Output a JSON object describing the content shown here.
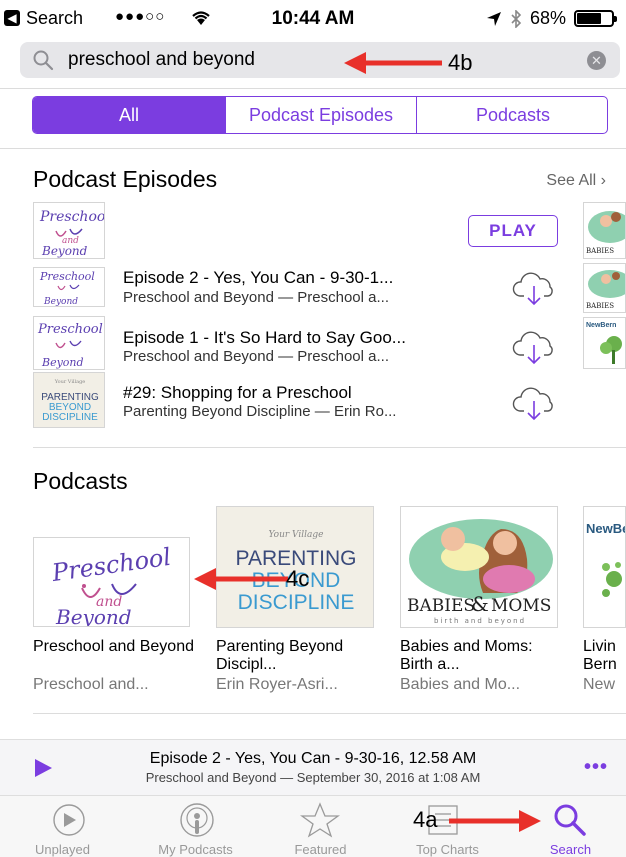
{
  "status_bar": {
    "carrier": "Search",
    "time": "10:44 AM",
    "battery": "68%",
    "battery_level": 0.68
  },
  "search": {
    "value": "preschool and beyond",
    "placeholder": "Search"
  },
  "segments": [
    {
      "label": "All",
      "active": true
    },
    {
      "label": "Podcast Episodes",
      "active": false
    },
    {
      "label": "Podcasts",
      "active": false
    }
  ],
  "episodes_section": {
    "title": "Podcast Episodes",
    "see_all": "See All",
    "play_label": "PLAY",
    "items": [
      {
        "title": "Episode 2 - Yes, You Can - 9-30-1...",
        "subtitle": "Preschool and Beyond — Preschool a..."
      },
      {
        "title": "Episode 1 - It's So Hard to Say Goo...",
        "subtitle": "Preschool and Beyond — Preschool a..."
      },
      {
        "title": "#29: Shopping for a Preschool",
        "subtitle": "Parenting Beyond Discipline — Erin Ro..."
      }
    ]
  },
  "podcasts_section": {
    "title": "Podcasts",
    "items": [
      {
        "title": "Preschool and Beyond",
        "author": "Preschool and..."
      },
      {
        "title": "Parenting Beyond Discipl...",
        "author": "Erin Royer-Asri..."
      },
      {
        "title": "Babies and Moms: Birth a...",
        "author": "Babies and Mo..."
      },
      {
        "title": "Livin Bern",
        "author": "New"
      }
    ]
  },
  "artwork": {
    "preschool": {
      "line1": "Preschool",
      "line2": "and",
      "line3": "Beyond"
    },
    "parenting": {
      "brand": "Your Village",
      "line1": "PARENTING",
      "line2": "BEYOND",
      "line3": "DISCIPLINE"
    },
    "babies": {
      "line1": "BABIES",
      "amp": "&",
      "line2": "MOMS",
      "tagline": "birth and beyond"
    },
    "newbern": {
      "brand": "NewBern"
    }
  },
  "annotations": {
    "a": "4a",
    "b": "4b",
    "c": "4c"
  },
  "mini_player": {
    "title": "Episode 2 - Yes, You Can - 9-30-16, 12.58 AM",
    "subtitle": "Preschool and Beyond — September 30, 2016 at 1:08 AM",
    "more": "•••"
  },
  "tab_bar": [
    {
      "label": "Unplayed",
      "icon": "play-circle-icon",
      "active": false
    },
    {
      "label": "My Podcasts",
      "icon": "podcast-icon",
      "active": false
    },
    {
      "label": "Featured",
      "icon": "star-icon",
      "active": false
    },
    {
      "label": "Top Charts",
      "icon": "list-icon",
      "active": false
    },
    {
      "label": "Search",
      "icon": "search-icon",
      "active": true
    }
  ],
  "colors": {
    "accent": "#7b3de0",
    "annotation_arrow": "#e8302a"
  }
}
